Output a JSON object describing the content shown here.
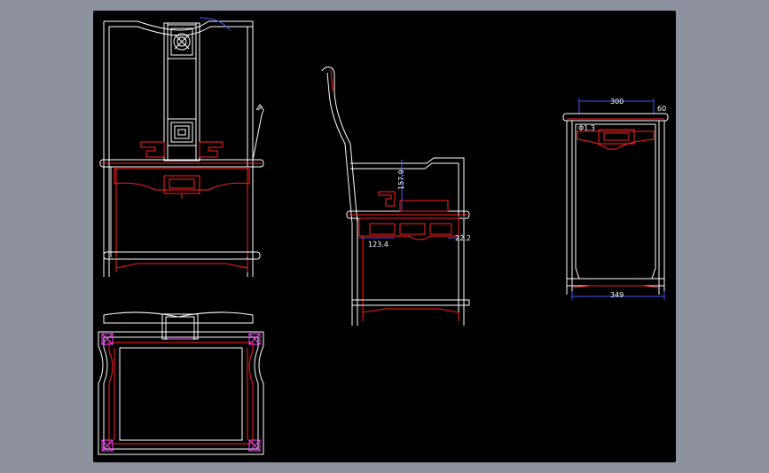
{
  "colors": {
    "background": "#8e929f",
    "viewport": "#000000",
    "outline": "#ffffff",
    "detail": "#ff2020",
    "dimension": "#3a5cff",
    "corner_marker": "#ff44ff"
  },
  "dimensions": {
    "side_seat_height_dim": "157.9",
    "side_apron_width_dim": "123.4",
    "side_right_dim": "22.2",
    "top_width_dim": "300",
    "top_edge_dim": "60",
    "inner_radius_dim": "Φ1.3",
    "bottom_width_dim": "349"
  }
}
